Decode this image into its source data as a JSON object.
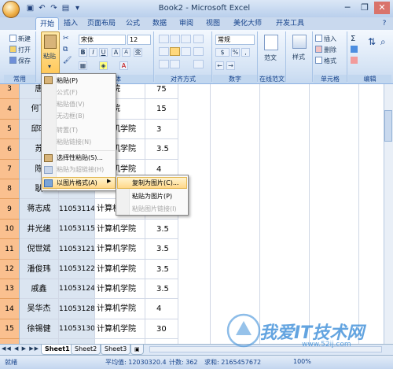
{
  "window": {
    "title": "Book2 - Microsoft Excel",
    "minimize": "─",
    "restore": "❐",
    "close": "✕"
  },
  "tabs": [
    "开始",
    "插入",
    "页面布局",
    "公式",
    "数据",
    "审阅",
    "视图",
    "美化大师",
    "开发工具"
  ],
  "help": "?",
  "clipboard": {
    "new": "新建",
    "open": "打开",
    "save": "保存",
    "group_label": "常用",
    "paste": "粘贴"
  },
  "font": {
    "name": "宋体",
    "size": "12",
    "bold": "B",
    "italic": "I",
    "underline": "U",
    "grow": "A",
    "shrink": "A",
    "phonetic": "变",
    "font_color_letter": "A",
    "group_label": "字体"
  },
  "alignment": {
    "group_label": "对齐方式"
  },
  "number": {
    "format": "常规",
    "group_label": "数字"
  },
  "style_group": {
    "label_range": "范文",
    "group_label": "在线范文",
    "style": "样式"
  },
  "cells": {
    "insert": "插入",
    "delete": "删除",
    "format": "格式",
    "group_label": "单元格"
  },
  "editing": {
    "sum": "Σ",
    "group_label": "编辑"
  },
  "sheet": {
    "row_numbers": [
      "3",
      "4",
      "5",
      "6",
      "7",
      "8",
      "9",
      "10",
      "11",
      "12",
      "13",
      "14",
      "15",
      "16"
    ],
    "rows": [
      {
        "name": "唐",
        "id": "",
        "college": "机学院",
        "score": "75"
      },
      {
        "name": "何飞",
        "id": "",
        "college": "机学院",
        "score": "15"
      },
      {
        "name": "邱晓",
        "id": "",
        "college": "计算机学院",
        "score": "3"
      },
      {
        "name": "苏",
        "id": "",
        "college": "计算机学院",
        "score": "3.5"
      },
      {
        "name": "陈",
        "id": "",
        "college": "计算机学院",
        "score": "4"
      },
      {
        "name": "耿",
        "id": "",
        "college": "",
        "score": ""
      },
      {
        "name": "蒋志成",
        "id": "11053114",
        "college": "计算机学院",
        "score": "3.5"
      },
      {
        "name": "井光绪",
        "id": "11053115",
        "college": "计算机学院",
        "score": "3.5"
      },
      {
        "name": "倪世斌",
        "id": "11053121",
        "college": "计算机学院",
        "score": "3.5"
      },
      {
        "name": "潘俊玮",
        "id": "11053122",
        "college": "计算机学院",
        "score": "3.5"
      },
      {
        "name": "戚鑫",
        "id": "11053124",
        "college": "计算机学院",
        "score": "3.5"
      },
      {
        "name": "吴华杰",
        "id": "11053128",
        "college": "计算机学院",
        "score": "4"
      },
      {
        "name": "徐锡健",
        "id": "11053130",
        "college": "计算机学院",
        "score": "30"
      },
      {
        "name": "钱红林",
        "id": "11053203",
        "college": "计算机学院",
        "score": "20"
      }
    ]
  },
  "context_menu": {
    "items": [
      {
        "label": "粘贴(P)",
        "enabled": true
      },
      {
        "label": "公式(F)",
        "enabled": false
      },
      {
        "label": "粘贴值(V)",
        "enabled": false
      },
      {
        "label": "无边框(B)",
        "enabled": false
      },
      {
        "label": "转置(T)",
        "enabled": false
      },
      {
        "label": "粘贴链接(N)",
        "enabled": false
      },
      {
        "label": "选择性粘贴(S)...",
        "enabled": true
      },
      {
        "label": "粘贴为超链接(H)",
        "enabled": false
      },
      {
        "label": "以图片格式(A)",
        "enabled": true
      }
    ],
    "submenu": [
      {
        "label": "复制为图片(C)...",
        "enabled": true
      },
      {
        "label": "粘贴为图片(P)",
        "enabled": true
      },
      {
        "label": "粘贴图片链接(I)",
        "enabled": false
      }
    ]
  },
  "sheet_tabs": [
    "Sheet1",
    "Sheet2",
    "Sheet3"
  ],
  "status": {
    "ready": "就绪",
    "average": "平均值: 12030320.4",
    "count": "计数: 362",
    "sum": "求和: 2165457672",
    "zoom": "100%"
  },
  "watermark": {
    "text": "我爱IT技术网",
    "url": "www.52ij.com"
  },
  "colors": {
    "row_header_selected": "#fac08f",
    "selected_cells": "#dbe5f1",
    "ribbon_blue": "#15428b",
    "menu_highlight": "#ffd88a"
  }
}
